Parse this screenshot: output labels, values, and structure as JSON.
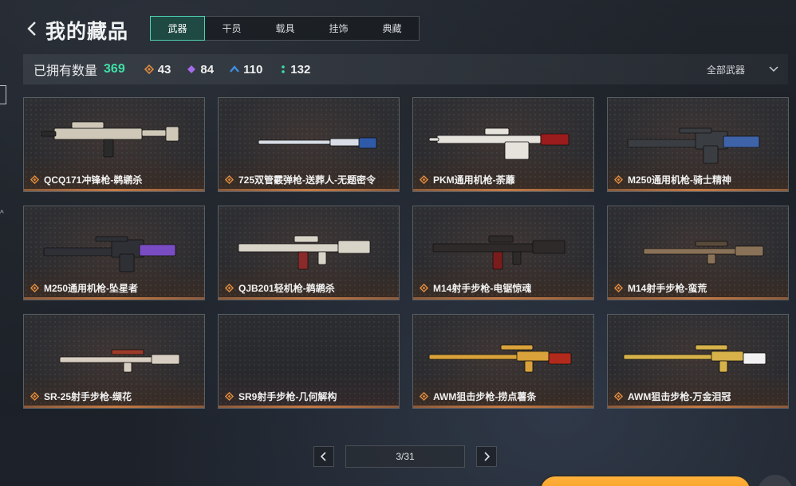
{
  "header": {
    "title": "我的藏品",
    "tabs": [
      {
        "label": "武器",
        "active": true
      },
      {
        "label": "干员",
        "active": false
      },
      {
        "label": "载具",
        "active": false
      },
      {
        "label": "挂饰",
        "active": false
      },
      {
        "label": "典藏",
        "active": false
      }
    ]
  },
  "stats": {
    "label": "已拥有数量",
    "total": "369",
    "gems": [
      {
        "icon": "orange-diamond-icon",
        "color": "#e08a3c",
        "count": "43"
      },
      {
        "icon": "purple-diamond-icon",
        "color": "#a56be8",
        "count": "84"
      },
      {
        "icon": "blue-chevron-icon",
        "color": "#3c8fe0",
        "count": "110"
      },
      {
        "icon": "green-dots-icon",
        "color": "#3fe0a6",
        "count": "132"
      }
    ],
    "filter_label": "全部武器"
  },
  "items": [
    {
      "name": "QCQ171冲锋枪-鹈鹕杀",
      "gun": "smg",
      "body": "#cfc8b8",
      "accent": "#2a2a2a"
    },
    {
      "name": "725双管霰弹枪-送葬人-无题密令",
      "gun": "shotgun",
      "body": "#d8dde6",
      "accent": "#2f5aa8"
    },
    {
      "name": "PKM通用机枪-荼蘼",
      "gun": "lmg",
      "body": "#e6e2dc",
      "accent": "#9b1c1c"
    },
    {
      "name": "M250通用机枪-骑士精神",
      "gun": "lmg2",
      "body": "#3a3d42",
      "accent": "#3f63a8"
    },
    {
      "name": "M250通用机枪-坠星者",
      "gun": "lmg2",
      "body": "#2f3036",
      "accent": "#7a4cc4"
    },
    {
      "name": "QJB201轻机枪-鹈鹕杀",
      "gun": "ar",
      "body": "#d9d4c8",
      "accent": "#8a2a2a"
    },
    {
      "name": "M14射手步枪-电锯惊魂",
      "gun": "ar",
      "body": "#2e2a2a",
      "accent": "#7a1c1c"
    },
    {
      "name": "M14射手步枪-蛮荒",
      "gun": "dmr",
      "body": "#8a7258",
      "accent": "#5a4a3a"
    },
    {
      "name": "SR-25射手步枪-缬花",
      "gun": "dmr",
      "body": "#d8cfc2",
      "accent": "#9c3a2a"
    },
    {
      "name": "SR9射手步枪-几何解构",
      "gun": "none",
      "body": "#444",
      "accent": "#444"
    },
    {
      "name": "AWM狙击步枪-捞点薯条",
      "gun": "sniper",
      "body": "#d9a23a",
      "accent": "#b22a1c"
    },
    {
      "name": "AWM狙击步枪-万金泪冠",
      "gun": "sniper",
      "body": "#d7b24a",
      "accent": "#f2f2f2"
    }
  ],
  "pagination": {
    "text": "3/31"
  }
}
